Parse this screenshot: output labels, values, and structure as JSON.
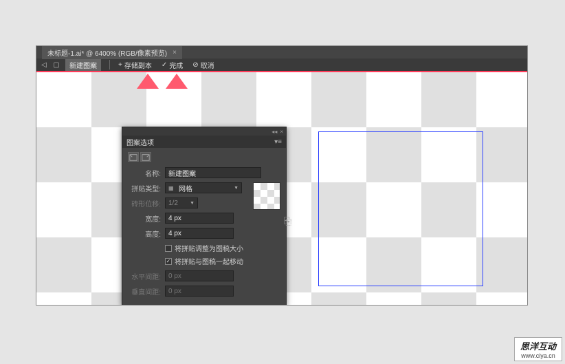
{
  "tab": {
    "title": "未标题-1.ai* @ 6400% (RGB/像素预览)"
  },
  "actionbar": {
    "newpattern": "新建图案",
    "savecopy": "存储副本",
    "done": "完成",
    "cancel": "取消"
  },
  "panel": {
    "title": "图案选项",
    "name_label": "名称:",
    "name_value": "新建图案",
    "tiletype_label": "拼贴类型:",
    "tiletype_value": "网格",
    "brickoffset_label": "砖形位移:",
    "brickoffset_value": "1/2",
    "width_label": "宽度:",
    "width_value": "4 px",
    "height_label": "高度:",
    "height_value": "4 px",
    "fit_checkbox": "将拼贴调整为图稿大小",
    "move_checkbox": "将拼贴与图稿一起移动",
    "hspacing_label": "水平间距:",
    "hspacing_value": "0 px",
    "vspacing_label": "垂直间距:",
    "vspacing_value": "0 px"
  },
  "watermark": {
    "cn": "思洋互动",
    "url": "www.ciya.cn"
  }
}
